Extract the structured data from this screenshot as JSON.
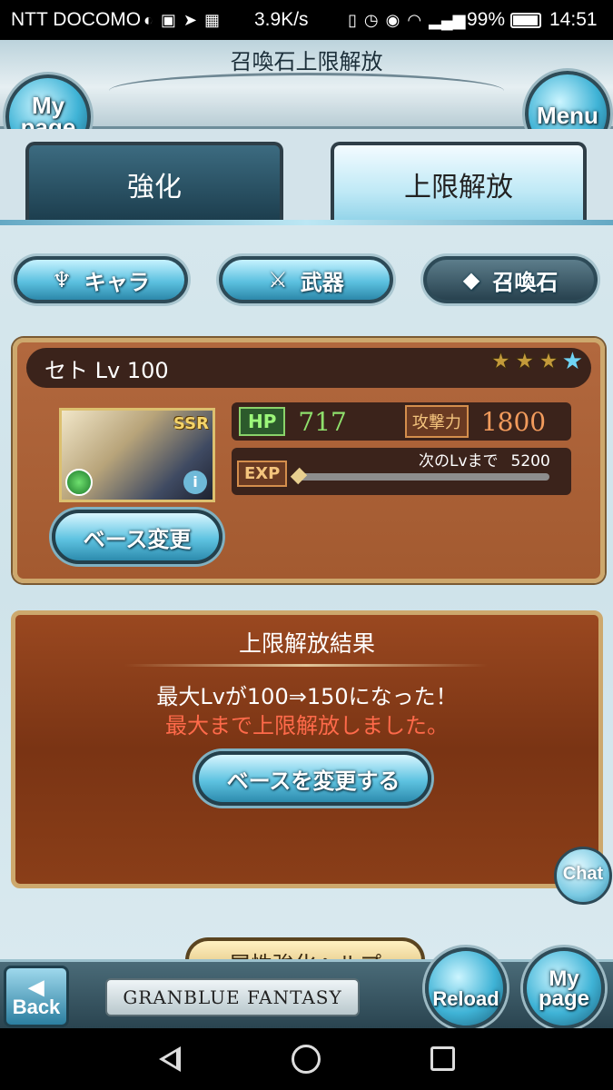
{
  "status_bar": {
    "carrier": "NTT DOCOMO",
    "speed": "3.9K/s",
    "battery": "99%",
    "time": "14:51",
    "icons": [
      "sync-icon",
      "nfc-icon",
      "signal-arrow-icon",
      "photo-icon",
      "vibrate-icon",
      "alarm-icon",
      "eye-icon",
      "wifi-icon",
      "signal-icon",
      "battery-icon"
    ]
  },
  "header": {
    "title": "召喚石上限解放",
    "mypage_label": "My page",
    "menu_label": "Menu"
  },
  "tabs": [
    {
      "label": "強化",
      "active": false
    },
    {
      "label": "上限解放",
      "active": true
    }
  ],
  "categories": [
    {
      "label": "キャラ",
      "icon": "chara-icon",
      "selected": false
    },
    {
      "label": "武器",
      "icon": "weapon-icon",
      "selected": false
    },
    {
      "label": "召喚石",
      "icon": "crystal-icon",
      "selected": true
    }
  ],
  "summon": {
    "name": "セト Lv 100",
    "stars": [
      "★",
      "★",
      "★",
      "★"
    ],
    "rarity": "SSR",
    "hp_label": "HP",
    "hp": "717",
    "atk_label": "攻撃力",
    "atk": "1800",
    "exp_label": "EXP",
    "next_level_label": "次のLvまで",
    "next_level_value": "5200",
    "exp_progress": 0.0,
    "base_change_label": "ベース変更"
  },
  "result": {
    "title": "上限解放結果",
    "message1": "最大Lvが100⇒150になった！",
    "message2": "最大まで上限解放しました。",
    "change_base_label": "ベースを変更する"
  },
  "chat_label": "Chat",
  "help_label": "属性強化ヘルプ",
  "bottom": {
    "back_label": "Back",
    "logo": "GRANBLUE FANTASY",
    "reload_label": "Reload",
    "mypage_label": "My page"
  },
  "colors": {
    "accent_blue": "#5ec3e1",
    "panel_brown": "#a35a30",
    "hp_green": "#8fe06c",
    "atk_orange": "#f29b5c",
    "alert_red": "#ff6a4a"
  }
}
